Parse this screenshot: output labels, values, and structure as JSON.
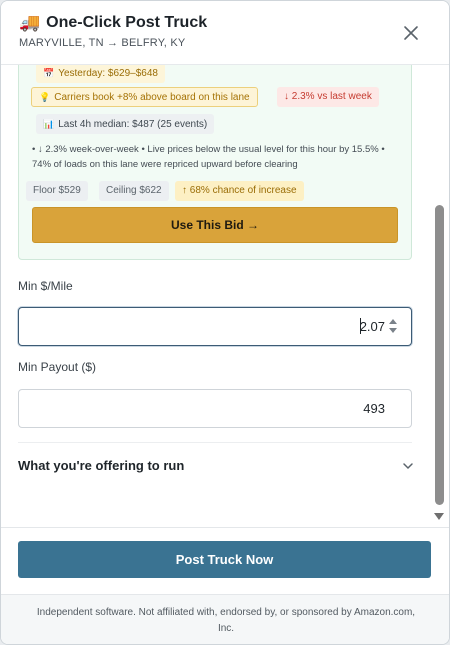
{
  "header": {
    "truck_icon": "🚚",
    "title": "One-Click Post Truck",
    "route": "MARYVILLE, TN → BELFRY, KY"
  },
  "insights": {
    "yesterday": "Yesterday: $629–$648",
    "carriers": "Carriers book +8% above board on this lane",
    "down_vs_last_week": "↓ 2.3% vs last week",
    "median": "Last 4h median: $487 (25 events)",
    "notes": "• ↓ 2.3% week-over-week • Live prices below the usual level for this hour by 15.5% • 74% of loads on this lane were repriced upward before clearing",
    "floor": "Floor $529",
    "ceiling": "Ceiling $622",
    "chance": "↑ 68% chance of increase",
    "use_bid_label": "Use This Bid →"
  },
  "form": {
    "min_per_mile_label": "Min $/Mile",
    "min_per_mile_value": "2.07",
    "min_payout_label": "Min Payout ($)",
    "min_payout_value": "493",
    "offering_label": "What you're offering to run"
  },
  "footer": {
    "post_label": "Post Truck Now",
    "disclaimer": "Independent software. Not affiliated with, endorsed by, or sponsored by Amazon.com, Inc."
  },
  "colors": {
    "accent": "#3a7392",
    "bid_button": "#d9a33a",
    "card_bg": "#f2fbf5"
  }
}
